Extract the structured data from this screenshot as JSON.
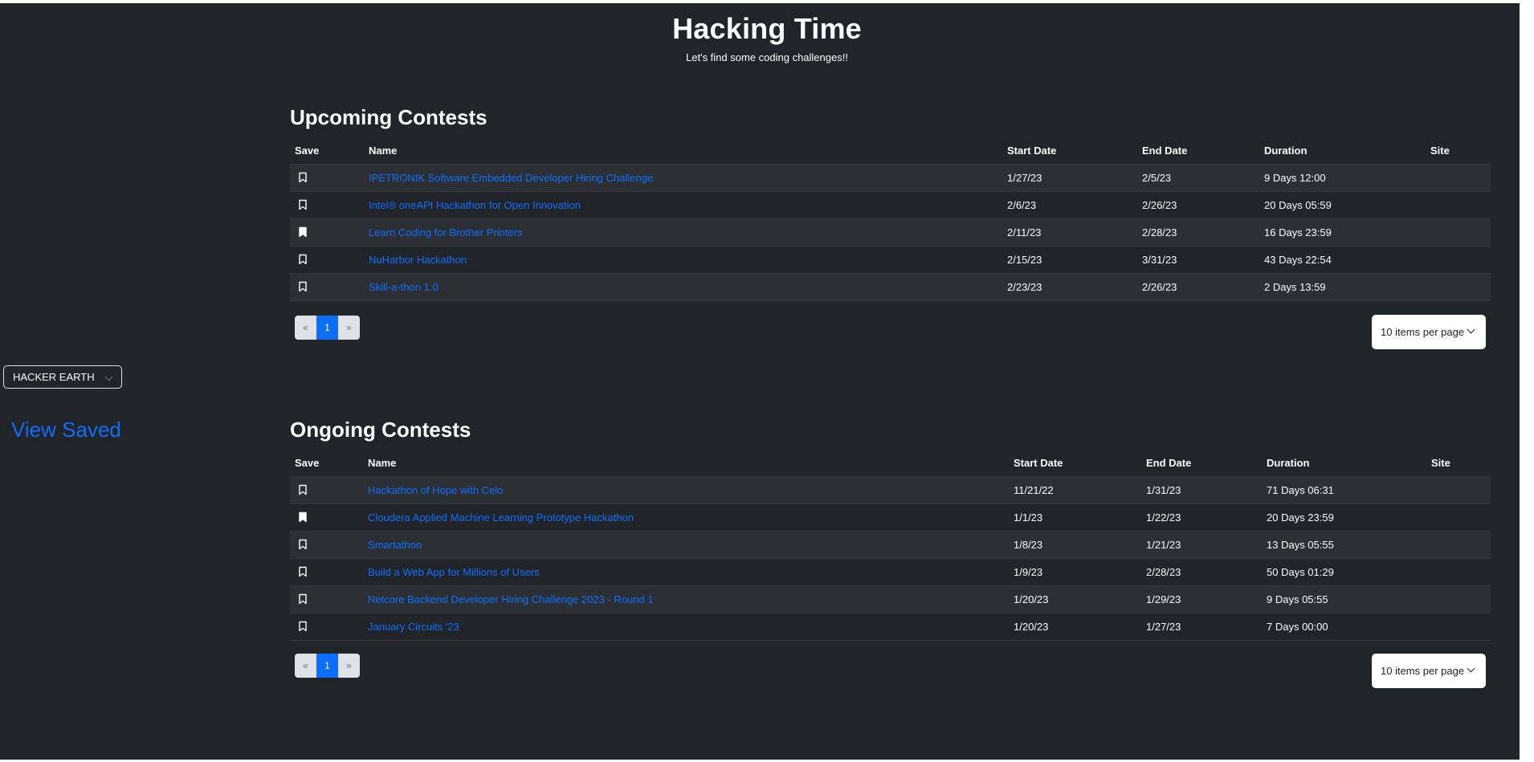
{
  "header": {
    "title": "Hacking Time",
    "subtitle": "Let's find some coding challenges!!"
  },
  "sidebar": {
    "site_select": "HACKER EARTH",
    "view_saved": "View Saved"
  },
  "columns": {
    "save": "Save",
    "name": "Name",
    "start_date": "Start Date",
    "end_date": "End Date",
    "duration": "Duration",
    "site": "Site"
  },
  "upcoming": {
    "title": "Upcoming Contests",
    "rows": [
      {
        "saved": false,
        "name": "IPETRONIK Software Embedded Developer Hiring Challenge",
        "start": "1/27/23",
        "end": "2/5/23",
        "duration": "9 Days 12:00",
        "site": ""
      },
      {
        "saved": false,
        "name": "Intel® oneAPI Hackathon for Open Innovation",
        "start": "2/6/23",
        "end": "2/26/23",
        "duration": "20 Days 05:59",
        "site": ""
      },
      {
        "saved": true,
        "name": "Learn Coding for Brother Printers",
        "start": "2/11/23",
        "end": "2/28/23",
        "duration": "16 Days 23:59",
        "site": ""
      },
      {
        "saved": false,
        "name": "NuHarbor Hackathon",
        "start": "2/15/23",
        "end": "3/31/23",
        "duration": "43 Days 22:54",
        "site": ""
      },
      {
        "saved": false,
        "name": "Skill-a-thon 1.0",
        "start": "2/23/23",
        "end": "2/26/23",
        "duration": "2 Days 13:59",
        "site": ""
      }
    ],
    "pagination": {
      "prev": "«",
      "current": "1",
      "next": "»"
    },
    "per_page": "10 items per page"
  },
  "ongoing": {
    "title": "Ongoing Contests",
    "rows": [
      {
        "saved": false,
        "name": "Hackathon of Hope with Celo",
        "start": "11/21/22",
        "end": "1/31/23",
        "duration": "71 Days 06:31",
        "site": ""
      },
      {
        "saved": true,
        "name": "Cloudera Applied Machine Learning Prototype Hackathon",
        "start": "1/1/23",
        "end": "1/22/23",
        "duration": "20 Days 23:59",
        "site": ""
      },
      {
        "saved": false,
        "name": "Smartathon",
        "start": "1/8/23",
        "end": "1/21/23",
        "duration": "13 Days 05:55",
        "site": ""
      },
      {
        "saved": false,
        "name": "Build a Web App for Millions of Users",
        "start": "1/9/23",
        "end": "2/28/23",
        "duration": "50 Days 01:29",
        "site": ""
      },
      {
        "saved": false,
        "name": "Netcore Backend Developer Hiring Challenge 2023 - Round 1",
        "start": "1/20/23",
        "end": "1/29/23",
        "duration": "9 Days 05:55",
        "site": ""
      },
      {
        "saved": false,
        "name": "January Circuits '23",
        "start": "1/20/23",
        "end": "1/27/23",
        "duration": "7 Days 00:00",
        "site": ""
      }
    ],
    "pagination": {
      "prev": "«",
      "current": "1",
      "next": "»"
    },
    "per_page": "10 items per page"
  },
  "colors": {
    "background": "#212529",
    "link": "#0d6efd",
    "stripe": "#2c3034"
  },
  "icons": {
    "bookmark_empty": "bookmark-icon",
    "bookmark_filled": "bookmark-filled-icon"
  }
}
